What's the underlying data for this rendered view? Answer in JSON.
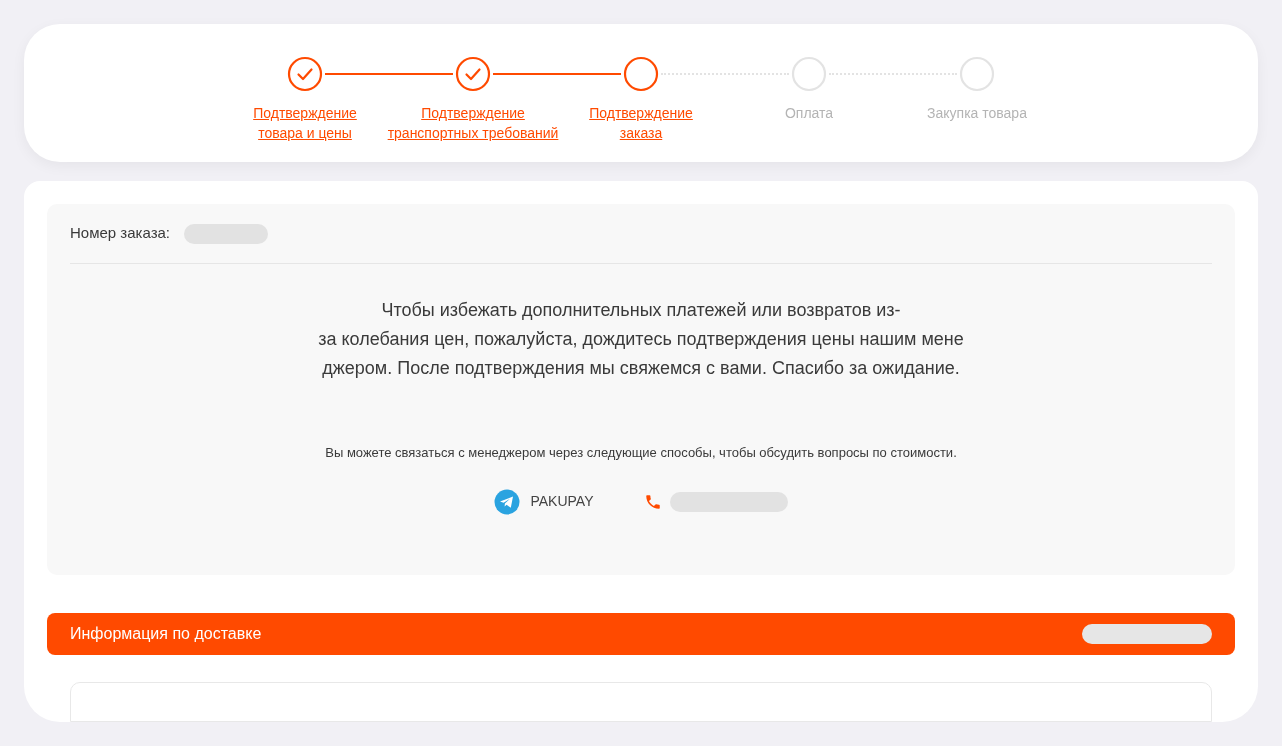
{
  "steps": [
    {
      "label_lines": [
        "Подтверждение",
        "товара и цены"
      ],
      "completed": true,
      "reached": true
    },
    {
      "label_lines": [
        "Подтверждение",
        "транспортных требований"
      ],
      "completed": true,
      "reached": true
    },
    {
      "label_lines": [
        "Подтверждение",
        "заказа"
      ],
      "completed": false,
      "reached": true
    },
    {
      "label_lines": [
        "Оплата"
      ],
      "completed": false,
      "reached": false
    },
    {
      "label_lines": [
        "Закупка товара"
      ],
      "completed": false,
      "reached": false
    }
  ],
  "order": {
    "label": "Номер заказа:"
  },
  "message_lines": [
    "Чтобы избежать дополнительных платежей или возвратов из-",
    "за колебания цен, пожалуйста, дождитесь подтверждения цены нашим мене",
    "джером. После подтверждения мы свяжемся с вами. Спасибо за ожидание."
  ],
  "contact_hint": "Вы можете связаться с менеджером через следующие способы, чтобы обсудить вопросы по стоимости.",
  "contacts": [
    {
      "kind": "telegram",
      "text": "PAKUPAY"
    },
    {
      "kind": "phone"
    }
  ],
  "delivery": {
    "title": "Информация по доставке"
  }
}
